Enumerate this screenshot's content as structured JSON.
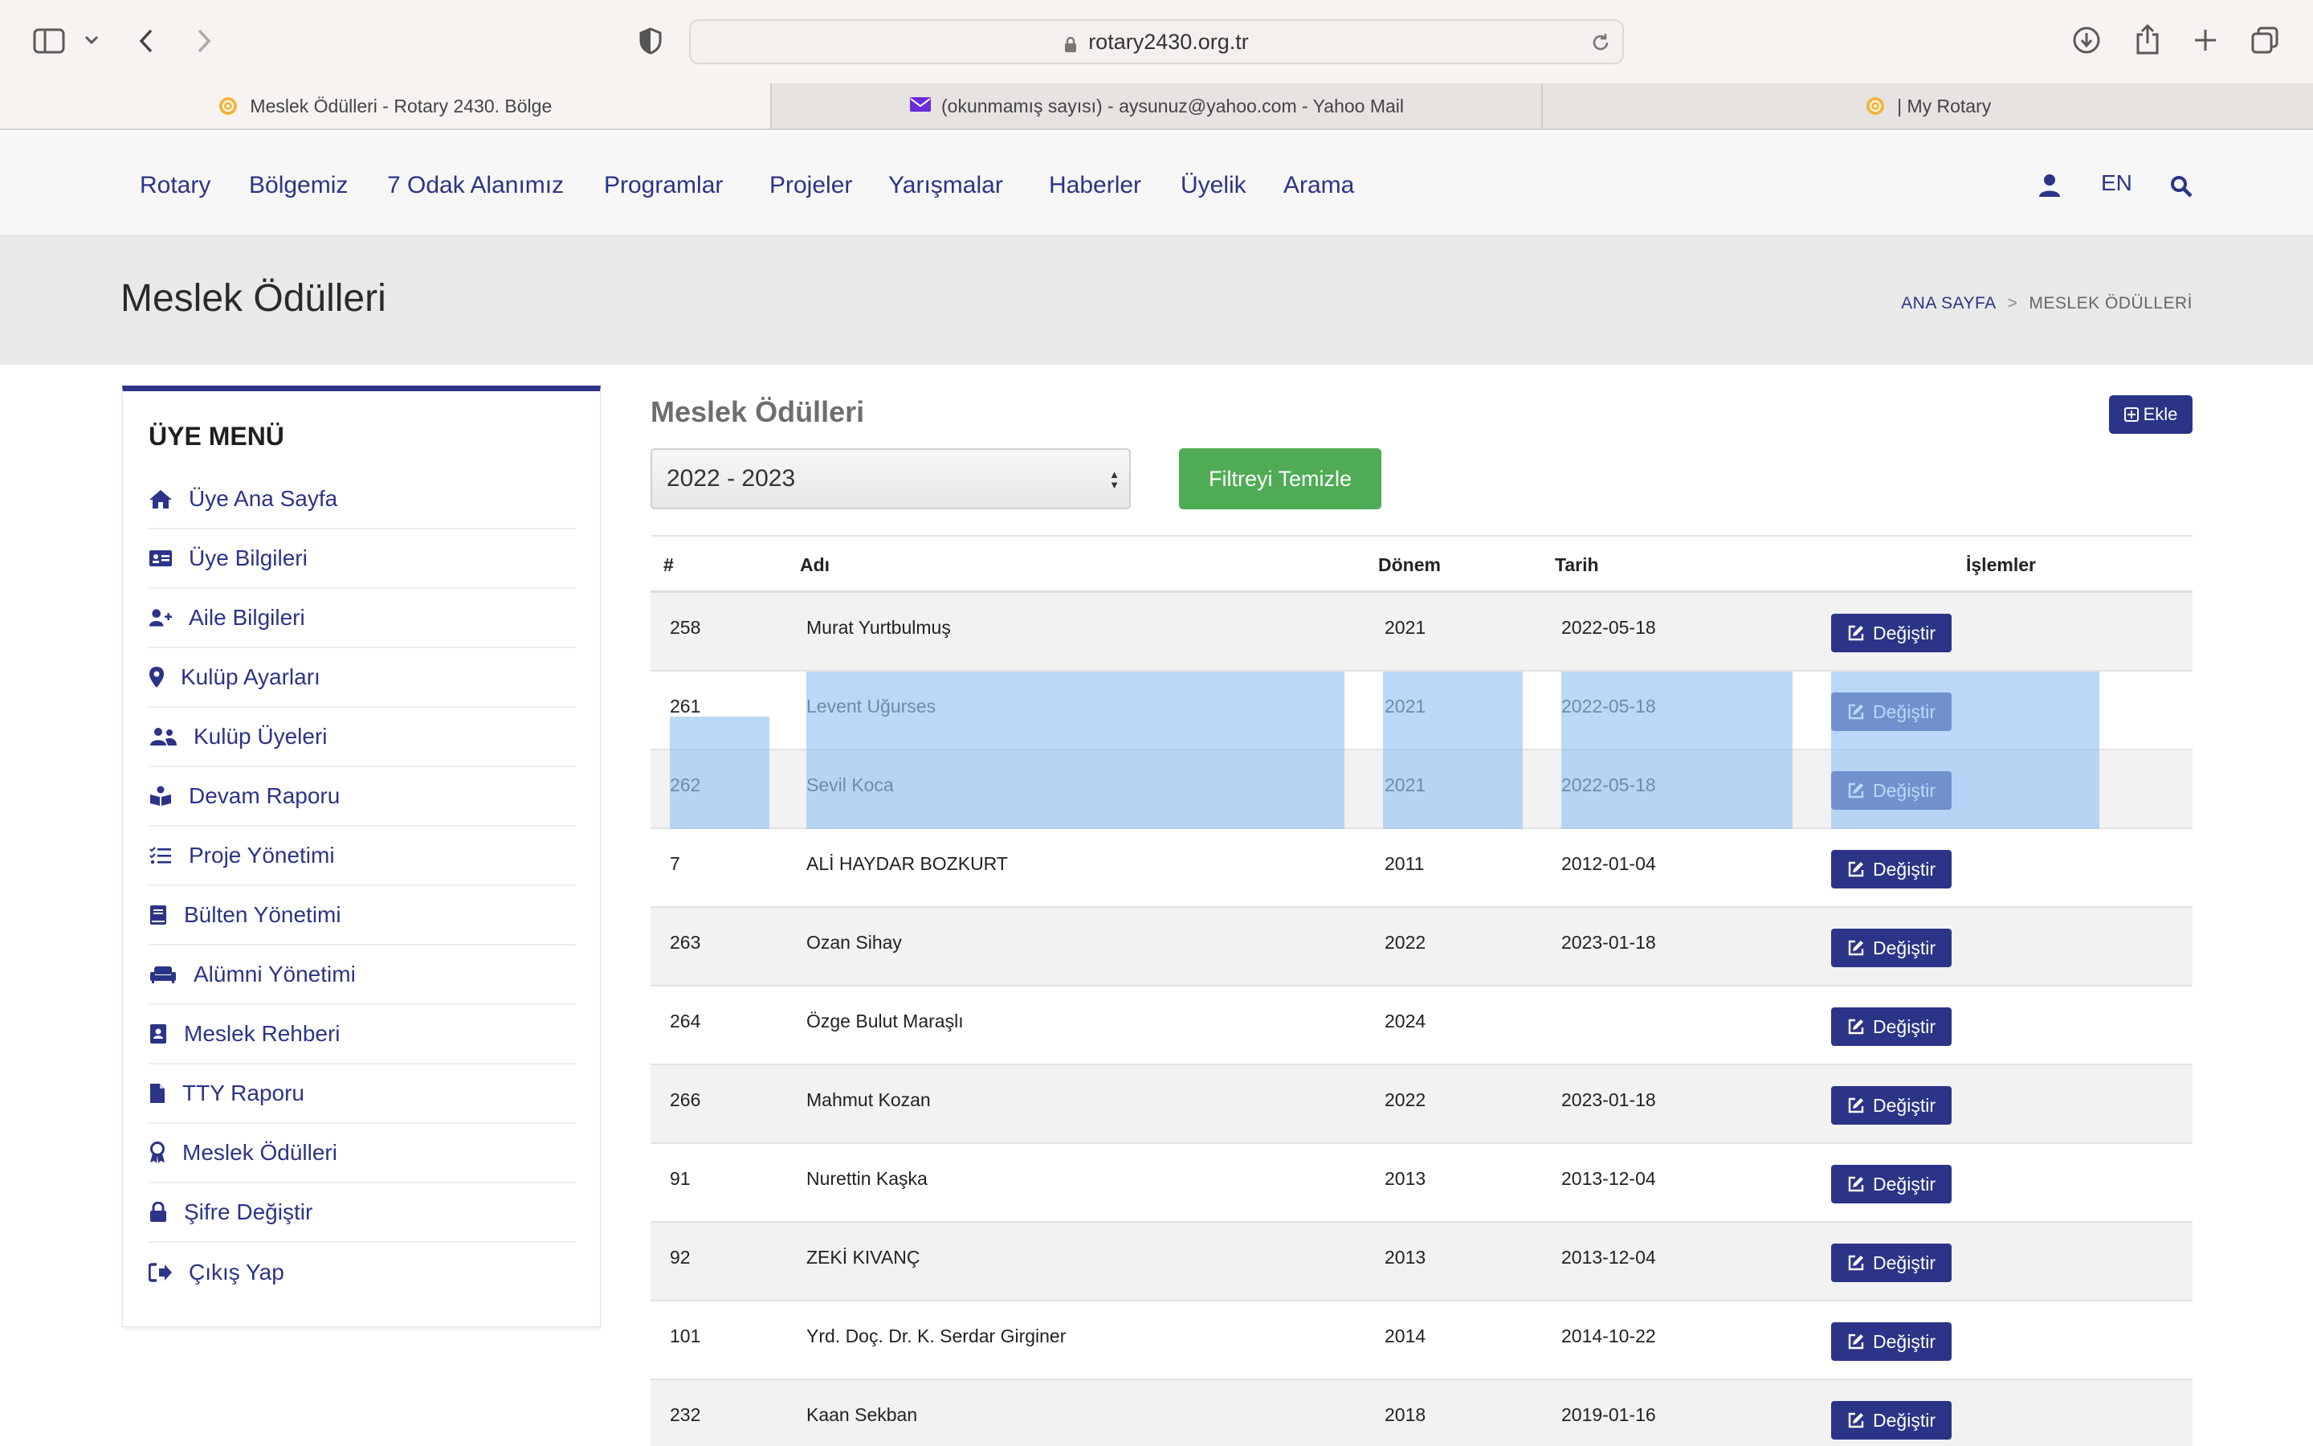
{
  "browser": {
    "url": "rotary2430.org.tr",
    "tabs": [
      {
        "title": "Meslek Ödülleri - Rotary 2430. Bölge",
        "favicon": "rotary-wheel-icon"
      },
      {
        "title": "(okunmamış sayısı) - aysunuz@yahoo.com - Yahoo Mail",
        "favicon": "mail-icon"
      },
      {
        "title": "| My Rotary",
        "favicon": "rotary-wheel-icon"
      }
    ]
  },
  "nav": {
    "items": [
      "Rotary",
      "Bölgemiz",
      "7 Odak Alanımız",
      "Programlar",
      "Projeler",
      "Yarışmalar",
      "Haberler",
      "Üyelik",
      "Arama"
    ],
    "lang": "EN"
  },
  "header": {
    "title": "Meslek Ödülleri",
    "breadcrumb_home": "ANA SAYFA",
    "breadcrumb_current": "MESLEK ÖDÜLLERİ"
  },
  "sidebar": {
    "title": "ÜYE MENÜ",
    "items": [
      {
        "label": "Üye Ana Sayfa",
        "icon": "home-icon"
      },
      {
        "label": "Üye Bilgileri",
        "icon": "id-card-icon"
      },
      {
        "label": "Aile Bilgileri",
        "icon": "user-plus-icon"
      },
      {
        "label": "Kulüp Ayarları",
        "icon": "map-pin-icon"
      },
      {
        "label": "Kulüp Üyeleri",
        "icon": "users-icon"
      },
      {
        "label": "Devam Raporu",
        "icon": "book-reader-icon"
      },
      {
        "label": "Proje Yönetimi",
        "icon": "tasks-icon"
      },
      {
        "label": "Bülten Yönetimi",
        "icon": "book-icon"
      },
      {
        "label": "Alümni Yönetimi",
        "icon": "couch-icon"
      },
      {
        "label": "Meslek Rehberi",
        "icon": "address-book-icon"
      },
      {
        "label": "TTY Raporu",
        "icon": "file-icon"
      },
      {
        "label": "Meslek Ödülleri",
        "icon": "award-icon"
      },
      {
        "label": "Şifre Değiştir",
        "icon": "lock-icon"
      },
      {
        "label": "Çıkış Yap",
        "icon": "sign-out-icon"
      }
    ]
  },
  "main": {
    "title": "Meslek Ödülleri",
    "add_label": "Ekle",
    "filter_select": "2022 - 2023",
    "filter_clear": "Filtreyi Temizle",
    "columns": [
      "#",
      "Adı",
      "Dönem",
      "Tarih",
      "İşlemler"
    ],
    "edit_label": "Değiştir",
    "rows": [
      {
        "id": "258",
        "name": "Murat Yurtbulmuş",
        "period": "2021",
        "date": "2022-05-18"
      },
      {
        "id": "261",
        "name": "Levent Uğurses",
        "period": "2021",
        "date": "2022-05-18"
      },
      {
        "id": "262",
        "name": "Sevil Koca",
        "period": "2021",
        "date": "2022-05-18"
      },
      {
        "id": "7",
        "name": "ALİ HAYDAR BOZKURT",
        "period": "2011",
        "date": "2012-01-04"
      },
      {
        "id": "263",
        "name": "Ozan Sihay",
        "period": "2022",
        "date": "2023-01-18"
      },
      {
        "id": "264",
        "name": "Özge Bulut Maraşlı",
        "period": "2024",
        "date": ""
      },
      {
        "id": "266",
        "name": "Mahmut Kozan",
        "period": "2022",
        "date": "2023-01-18"
      },
      {
        "id": "91",
        "name": "Nurettin Kaşka",
        "period": "2013",
        "date": "2013-12-04"
      },
      {
        "id": "92",
        "name": "ZEKİ KIVANÇ",
        "period": "2013",
        "date": "2013-12-04"
      },
      {
        "id": "101",
        "name": "Yrd. Doç. Dr. K. Serdar Girginer",
        "period": "2014",
        "date": "2014-10-22"
      },
      {
        "id": "232",
        "name": "Kaan Sekban",
        "period": "2018",
        "date": "2019-01-16"
      }
    ]
  }
}
